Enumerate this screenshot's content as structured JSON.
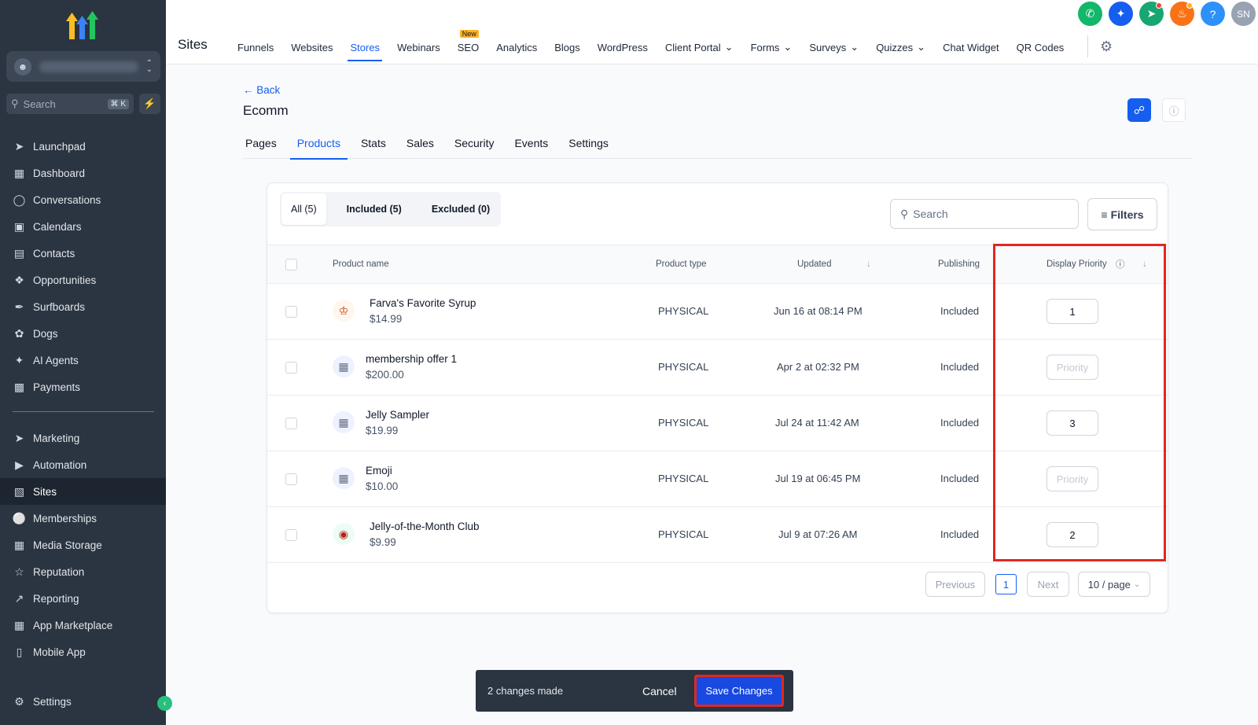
{
  "sidebar": {
    "search_placeholder": "Search",
    "search_shortcut": "⌘ K",
    "items": [
      {
        "label": "Launchpad",
        "icon": "rocket-icon"
      },
      {
        "label": "Dashboard",
        "icon": "grid-icon"
      },
      {
        "label": "Conversations",
        "icon": "chat-icon"
      },
      {
        "label": "Calendars",
        "icon": "calendar-icon"
      },
      {
        "label": "Contacts",
        "icon": "contacts-icon"
      },
      {
        "label": "Opportunities",
        "icon": "opportunities-icon"
      },
      {
        "label": "Surfboards",
        "icon": "surfboard-icon"
      },
      {
        "label": "Dogs",
        "icon": "dog-icon"
      },
      {
        "label": "AI Agents",
        "icon": "sparkle-icon"
      },
      {
        "label": "Payments",
        "icon": "receipt-icon"
      },
      {
        "label": "Marketing",
        "icon": "send-icon"
      },
      {
        "label": "Automation",
        "icon": "automation-icon"
      },
      {
        "label": "Sites",
        "icon": "sites-icon"
      },
      {
        "label": "Memberships",
        "icon": "badge-icon"
      },
      {
        "label": "Media Storage",
        "icon": "image-icon"
      },
      {
        "label": "Reputation",
        "icon": "star-icon"
      },
      {
        "label": "Reporting",
        "icon": "trend-icon"
      },
      {
        "label": "App Marketplace",
        "icon": "apps-icon"
      },
      {
        "label": "Mobile App",
        "icon": "phone-icon"
      },
      {
        "label": "Settings",
        "icon": "gear-icon"
      }
    ],
    "active_item": "Sites"
  },
  "topbar": {
    "title": "Sites",
    "nav": [
      "Funnels",
      "Websites",
      "Stores",
      "Webinars",
      "SEO",
      "Analytics",
      "Blogs",
      "WordPress",
      "Client Portal",
      "Forms",
      "Surveys",
      "Quizzes",
      "Chat Widget",
      "QR Codes"
    ],
    "active_nav": "Stores",
    "new_badge": "New",
    "user_initials": "SN",
    "help_glyph": "?"
  },
  "page": {
    "back_label": "Back",
    "title": "Ecomm",
    "tabs": [
      "Pages",
      "Products",
      "Stats",
      "Sales",
      "Security",
      "Events",
      "Settings"
    ],
    "active_tab": "Products"
  },
  "filters": {
    "segments": [
      "All (5)",
      "Included (5)",
      "Excluded (0)"
    ],
    "search_placeholder": "Search",
    "filters_label": "Filters"
  },
  "table": {
    "columns": [
      "Product name",
      "Product type",
      "Updated",
      "Publishing",
      "Display Priority"
    ],
    "rows": [
      {
        "name": "Farva's Favorite Syrup",
        "price": "$14.99",
        "type": "PHYSICAL",
        "updated": "Jun 16 at 08:14 PM",
        "publishing": "Included",
        "priority": "1",
        "thumb": "syrup-image"
      },
      {
        "name": "membership offer 1",
        "price": "$200.00",
        "type": "PHYSICAL",
        "updated": "Apr 2 at 02:32 PM",
        "publishing": "Included",
        "priority": "",
        "thumb": "placeholder-image-icon"
      },
      {
        "name": "Jelly Sampler",
        "price": "$19.99",
        "type": "PHYSICAL",
        "updated": "Jul 24 at 11:42 AM",
        "publishing": "Included",
        "priority": "3",
        "thumb": "placeholder-image-icon"
      },
      {
        "name": "Emoji",
        "price": "$10.00",
        "type": "PHYSICAL",
        "updated": "Jul 19 at 06:45 PM",
        "publishing": "Included",
        "priority": "",
        "thumb": "placeholder-image-icon"
      },
      {
        "name": "Jelly-of-the-Month Club",
        "price": "$9.99",
        "type": "PHYSICAL",
        "updated": "Jul 9 at 07:26 AM",
        "publishing": "Included",
        "priority": "2",
        "thumb": "jelly-image"
      }
    ],
    "priority_placeholder": "Priority"
  },
  "pagination": {
    "previous": "Previous",
    "page": "1",
    "next": "Next",
    "page_size": "10 / page"
  },
  "actionbar": {
    "changes": "2 changes made",
    "cancel": "Cancel",
    "save": "Save Changes"
  },
  "colors": {
    "accent": "#155eef",
    "sidebar_bg": "#2b3441",
    "highlight": "#e2271f"
  }
}
